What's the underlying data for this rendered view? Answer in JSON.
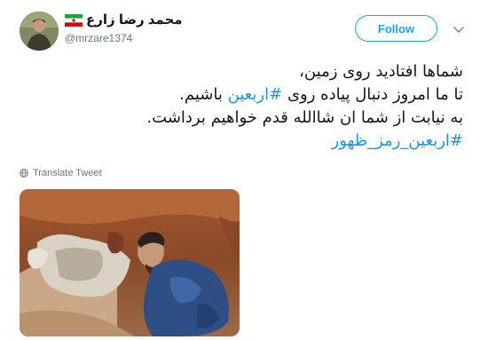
{
  "tweet": {
    "author_name": "محمد رضا زارع",
    "handle": "@mrzare1374",
    "follow_label": "Follow",
    "lines": [
      {
        "text": "شماها افتادید روی زمین،",
        "hashtag": ""
      },
      {
        "before": "تا ما امروز دنبال پیاده روی ",
        "hashtag": "#اربعین",
        "after": " باشیم."
      },
      {
        "text": "به نیابت از شما ان شاالله قدم خواهیم برداشت.",
        "hashtag": ""
      },
      {
        "text": "",
        "hashtag": "#اربعین_رمز_ظهور"
      }
    ],
    "translate_label": "Translate Tweet",
    "colors": {
      "accent": "#1da1f2",
      "hashtag": "#1b95e0",
      "muted": "#657786",
      "text": "#14171a"
    },
    "icons": {
      "flag": "iran-flag-icon",
      "caret": "chevron-down-icon",
      "translate": "globe-icon"
    }
  }
}
